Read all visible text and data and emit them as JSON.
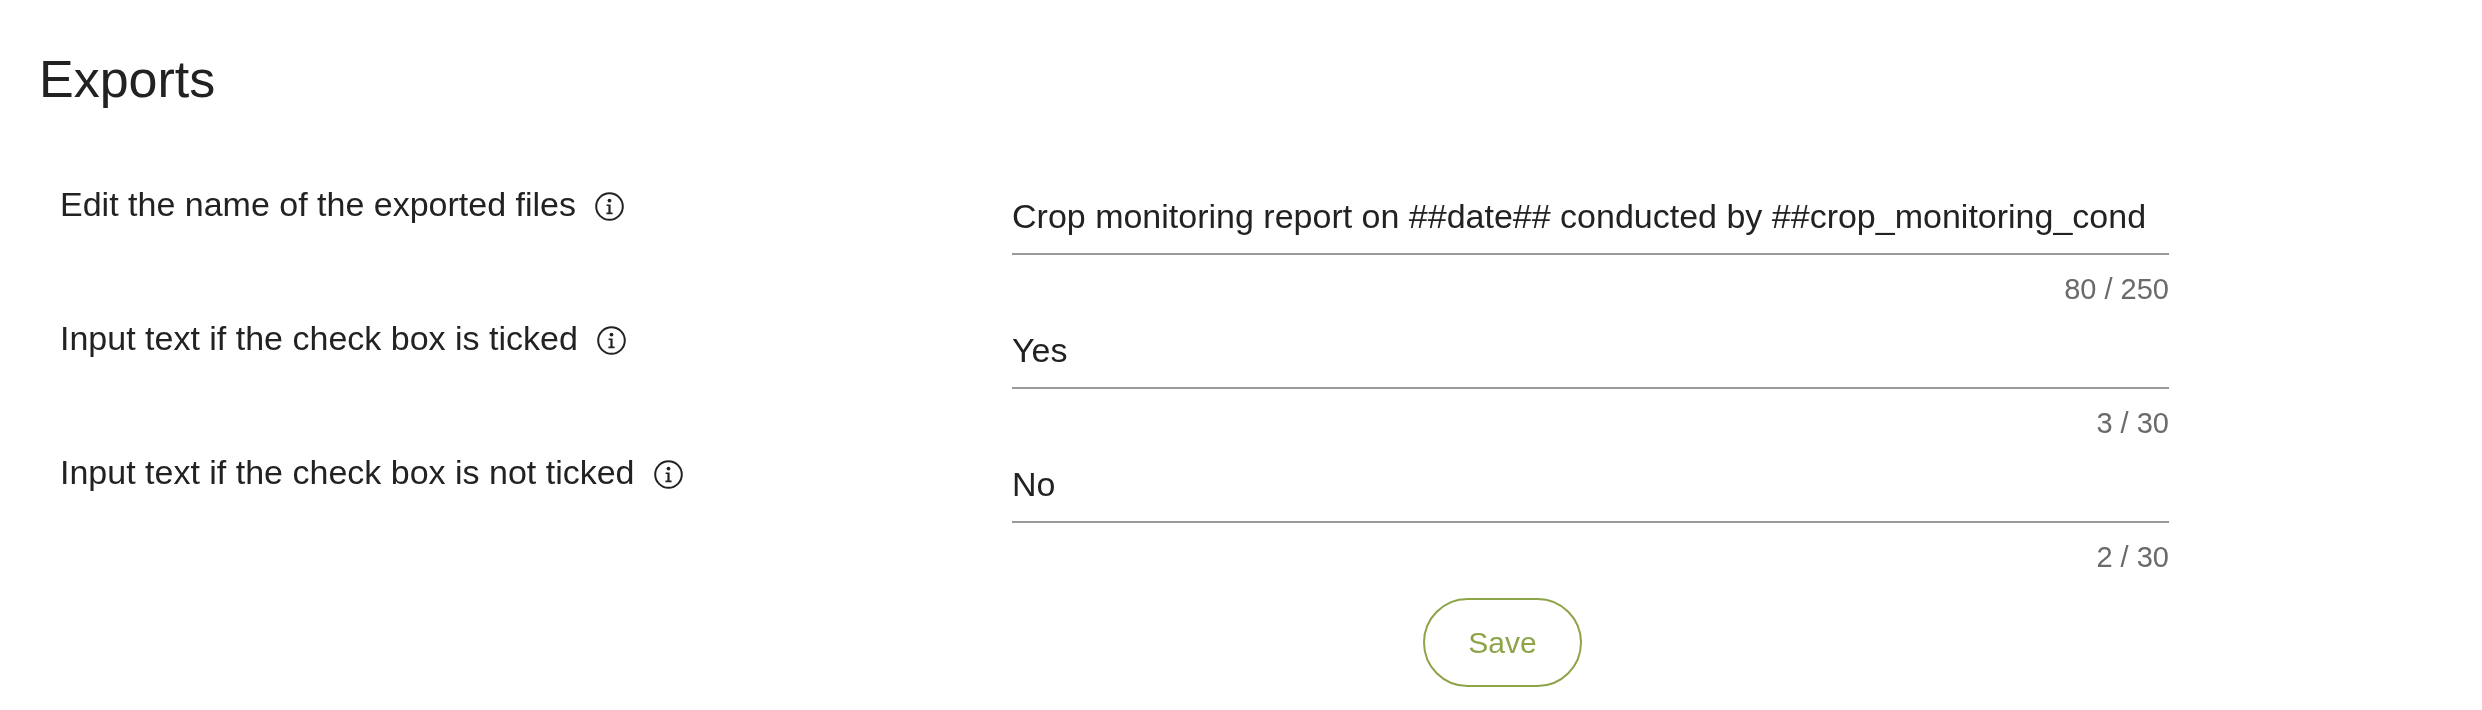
{
  "title": "Exports",
  "fields": [
    {
      "label": "Edit the name of the exported files",
      "value": "Crop monitoring report on ##date## conducted by ##crop_monitoring_cond",
      "counter": "80 / 250"
    },
    {
      "label": "Input text if the check box is ticked",
      "value": "Yes",
      "counter": "3 / 30"
    },
    {
      "label": "Input text if the check box is not ticked",
      "value": "No",
      "counter": "2 / 30"
    }
  ],
  "save_button": {
    "label": "Save"
  }
}
